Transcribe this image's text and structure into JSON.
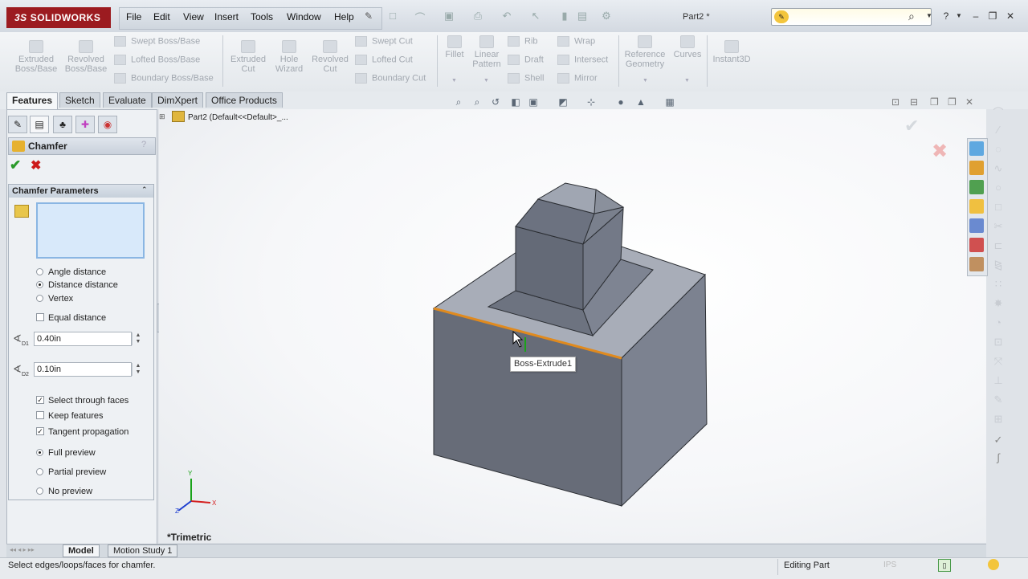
{
  "app": {
    "brand": "SOLIDWORKS",
    "brand_prefix": "3S",
    "doc_title": "Part2 *"
  },
  "menu": [
    "File",
    "Edit",
    "View",
    "Insert",
    "Tools",
    "Window",
    "Help"
  ],
  "commands": {
    "extruded_boss": "Extruded\nBoss/Base",
    "revolved_boss": "Revolved\nBoss/Base",
    "swept_boss": "Swept Boss/Base",
    "lofted_boss": "Lofted Boss/Base",
    "boundary_boss": "Boundary Boss/Base",
    "extruded_cut": "Extruded\nCut",
    "hole_wizard": "Hole\nWizard",
    "revolved_cut": "Revolved\nCut",
    "swept_cut": "Swept Cut",
    "lofted_cut": "Lofted Cut",
    "boundary_cut": "Boundary Cut",
    "fillet": "Fillet",
    "linear_pattern": "Linear\nPattern",
    "rib": "Rib",
    "draft": "Draft",
    "shell": "Shell",
    "wrap": "Wrap",
    "intersect": "Intersect",
    "mirror": "Mirror",
    "reference_geometry": "Reference\nGeometry",
    "curves": "Curves",
    "instant3d": "Instant3D"
  },
  "tabs": [
    "Features",
    "Sketch",
    "Evaluate",
    "DimXpert",
    "Office Products"
  ],
  "tree_root": "Part2  (Default<<Default>_...",
  "property_manager": {
    "title": "Chamfer",
    "help": "?",
    "group_title": "Chamfer Parameters",
    "options": {
      "angle_distance": "Angle distance",
      "distance_distance": "Distance distance",
      "vertex": "Vertex",
      "equal_distance": "Equal distance",
      "select_through_faces": "Select through faces",
      "keep_features": "Keep features",
      "tangent_propagation": "Tangent propagation",
      "full_preview": "Full preview",
      "partial_preview": "Partial preview",
      "no_preview": "No preview"
    },
    "d1_value": "0.40in",
    "d2_value": "0.10in",
    "d1_label": "D1",
    "d2_label": "D2"
  },
  "viewport": {
    "tooltip": "Boss-Extrude1",
    "view_name": "*Trimetric",
    "triad": {
      "x": "X",
      "y": "Y",
      "z": "Z"
    }
  },
  "bottom_tabs": [
    "Model",
    "Motion Study 1"
  ],
  "status": {
    "message": "Select edges/loops/faces for chamfer.",
    "mode": "Editing Part",
    "units": "IPS"
  },
  "colors": {
    "accent": "#9c1b20",
    "edge_highlight": "#e08a1e",
    "body": "#6f7582"
  }
}
